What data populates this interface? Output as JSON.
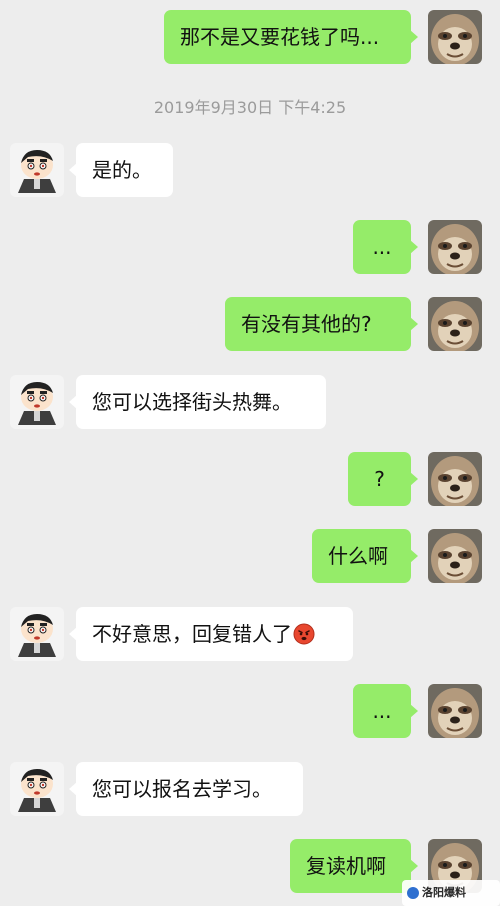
{
  "chat": {
    "timestamp": "2019年9月30日 下午4:25",
    "messages": [
      {
        "side": "out",
        "text": "那不是又要花钱了吗..."
      },
      {
        "side": "in",
        "text": "是的。"
      },
      {
        "side": "out",
        "text": "..."
      },
      {
        "side": "out",
        "text": "有没有其他的?"
      },
      {
        "side": "in",
        "text": "您可以选择街头热舞。"
      },
      {
        "side": "out",
        "text": "?"
      },
      {
        "side": "out",
        "text": "什么啊"
      },
      {
        "side": "in",
        "text": "不好意思，回复错人了"
      },
      {
        "side": "out",
        "text": "..."
      },
      {
        "side": "in",
        "text": "您可以报名去学习。"
      },
      {
        "side": "out",
        "text": "复读机啊"
      }
    ]
  },
  "avatars": {
    "self": "sloth-avatar-icon",
    "other": "crayon-shin-chan-avatar-icon"
  },
  "emoji": {
    "msg7": "blushing-face-emoji-icon"
  },
  "colors": {
    "background": "#ededed",
    "outgoing_bubble": "#95ec69",
    "incoming_bubble": "#ffffff",
    "timestamp_text": "#9b9b9b"
  },
  "watermark": {
    "text": "洛阳爆料"
  }
}
